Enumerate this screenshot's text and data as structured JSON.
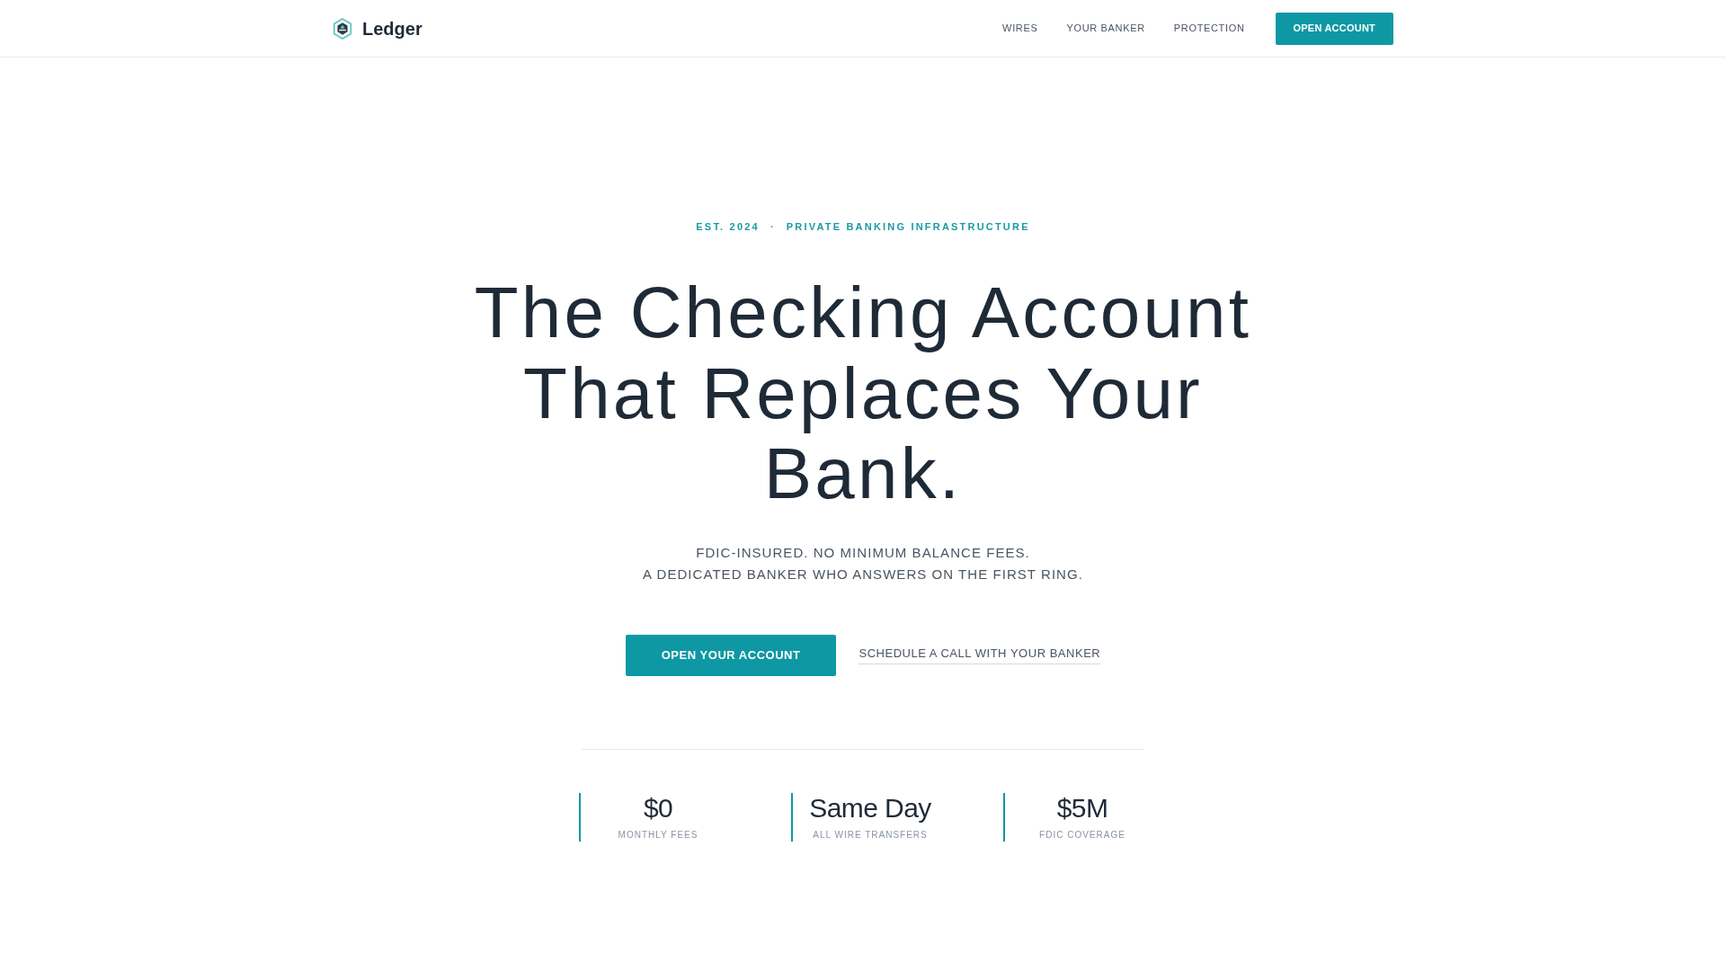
{
  "header": {
    "brand": "Ledger",
    "nav": [
      "WIRES",
      "YOUR BANKER",
      "PROTECTION"
    ],
    "cta": "OPEN ACCOUNT"
  },
  "hero": {
    "eyebrow": [
      "EST. 2024",
      "·",
      "PRIVATE BANKING INFRASTRUCTURE"
    ],
    "headline": "The Checking Account That Replaces Your Bank.",
    "subtitle": [
      "FDIC-INSURED. NO MINIMUM BALANCE FEES.",
      "A DEDICATED BANKER WHO ANSWERS ON THE FIRST RING."
    ],
    "primary_button": "OPEN YOUR ACCOUNT",
    "secondary_link": "SCHEDULE A CALL WITH YOUR BANKER"
  },
  "stats": [
    {
      "value": "$0",
      "label": "MONTHLY FEES"
    },
    {
      "value": "Same Day",
      "label": "ALL WIRE TRANSFERS"
    },
    {
      "value": "$5M",
      "label": "FDIC COVERAGE"
    }
  ]
}
